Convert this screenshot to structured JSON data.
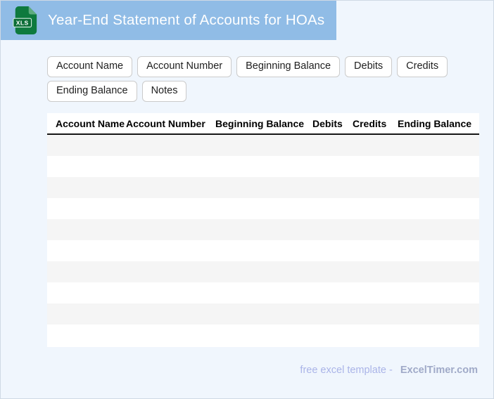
{
  "header": {
    "title": "Year-End Statement of Accounts for HOAs",
    "background_color": "#90bce6",
    "icon_label": "XLS",
    "icon_color": "#0e7a3e"
  },
  "chips": [
    "Account Name",
    "Account Number",
    "Beginning Balance",
    "Debits",
    "Credits",
    "Ending Balance",
    "Notes"
  ],
  "table": {
    "columns": [
      "Account Name",
      "Account Number",
      "Beginning Balance",
      "Debits",
      "Credits",
      "Ending Balance"
    ],
    "row_count": 10,
    "stripe_color": "#f5f5f5"
  },
  "footer": {
    "free_text": "free excel template -",
    "brand": "ExcelTimer.com"
  }
}
